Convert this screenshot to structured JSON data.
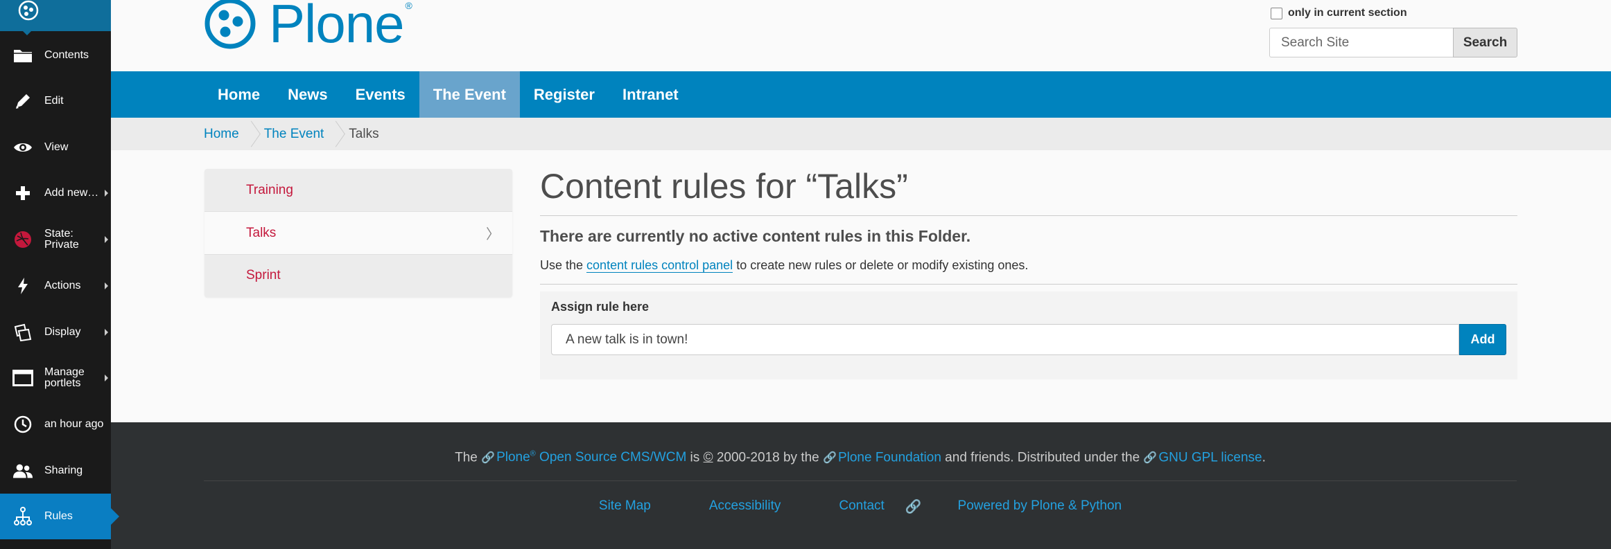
{
  "toolbar": {
    "logo_icon": "plone-logo-icon",
    "items": [
      {
        "label": "Contents",
        "icon": "folder-icon",
        "has_submenu": false
      },
      {
        "label": "Edit",
        "icon": "pencil-icon",
        "has_submenu": false
      },
      {
        "label": "View",
        "icon": "eye-icon",
        "has_submenu": false
      },
      {
        "label": "Add new…",
        "icon": "plus-icon",
        "has_submenu": true
      },
      {
        "label": "State:\nPrivate",
        "icon": "state-private-icon",
        "has_submenu": true
      },
      {
        "label": "Actions",
        "icon": "lightning-icon",
        "has_submenu": true
      },
      {
        "label": "Display",
        "icon": "display-icon",
        "has_submenu": true
      },
      {
        "label": "Manage\nportlets",
        "icon": "portlets-icon",
        "has_submenu": true
      },
      {
        "label": "an hour ago",
        "icon": "clock-icon",
        "has_submenu": false
      },
      {
        "label": "Sharing",
        "icon": "users-icon",
        "has_submenu": false
      },
      {
        "label": "Rules",
        "icon": "rules-icon",
        "has_submenu": false
      }
    ]
  },
  "header": {
    "logo_text": "Plone",
    "logo_mark": "®",
    "section_only_label": "only in current section",
    "search_placeholder": "Search Site",
    "search_button": "Search"
  },
  "globalnav": [
    "Home",
    "News",
    "Events",
    "The Event",
    "Register",
    "Intranet"
  ],
  "breadcrumbs": {
    "home": "Home",
    "parent": "The Event",
    "current": "Talks"
  },
  "portlet_nav": {
    "items": [
      "Training",
      "Talks",
      "Sprint"
    ],
    "chevron": "〉"
  },
  "main": {
    "title": "Content rules for “Talks”",
    "no_rules": "There are currently no active content rules in this Folder.",
    "help_before": "Use the ",
    "help_link": "content rules control panel",
    "help_after": " to create new rules or delete or modify existing ones.",
    "assign_label": "Assign rule here",
    "select_value": "A new talk is in town!",
    "add_button": "Add"
  },
  "footer": {
    "c1": "The ",
    "plone_link": "Plone",
    "reg": "®",
    "cms_link": " Open Source CMS/WCM",
    "c2": " is ",
    "copyright": "©",
    "c3": " 2000-2018 by the ",
    "foundation_link": "Plone Foundation",
    "c4": " and friends. Distributed under the ",
    "license_link": "GNU GPL license",
    "c5": ".",
    "links": [
      "Site Map",
      "Accessibility",
      "Contact",
      "Powered by Plone & Python"
    ]
  },
  "colors": {
    "toolbar_bg": "#1a1a1a",
    "toolbar_active": "#0a7ec2",
    "brand_blue": "#0083be",
    "nav_selected": "#69a4cc",
    "portlet_link": "#c4183c",
    "footer_bg": "#2e3133",
    "footer_link": "#23a1e0"
  }
}
